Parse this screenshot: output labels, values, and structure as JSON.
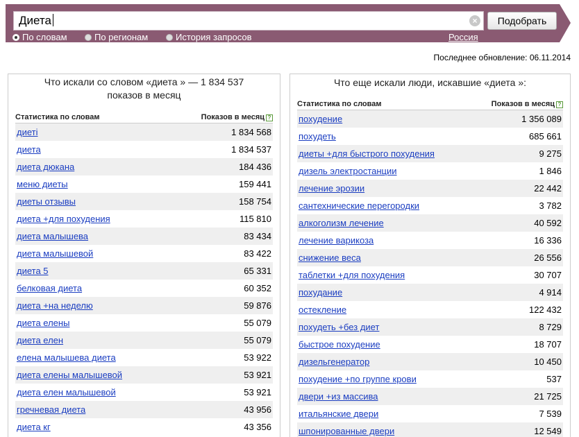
{
  "search": {
    "value": "Диета",
    "submit_label": "Подобрать"
  },
  "modes": [
    {
      "label": "По словам",
      "checked": true
    },
    {
      "label": "По регионам",
      "checked": false
    },
    {
      "label": "История запросов",
      "checked": false
    }
  ],
  "region": "Россия",
  "updated": "Последнее обновление: 06.11.2014",
  "left": {
    "title_line1": "Что искали со словом «диета » — 1 834 537",
    "title_line2": "показов в месяц",
    "col_keyword": "Статистика по словам",
    "col_count": "Показов в месяц",
    "rows": [
      {
        "keyword": "диеті",
        "count": "1 834 568"
      },
      {
        "keyword": "диета",
        "count": "1 834 537"
      },
      {
        "keyword": "диета дюкана",
        "count": "184 436"
      },
      {
        "keyword": "меню диеты",
        "count": "159 441"
      },
      {
        "keyword": "диеты отзывы",
        "count": "158 754"
      },
      {
        "keyword": "диета +для похудения",
        "count": "115 810"
      },
      {
        "keyword": "диета малышева",
        "count": "83 434"
      },
      {
        "keyword": "диета малышевой",
        "count": "83 422"
      },
      {
        "keyword": "диета 5",
        "count": "65 331"
      },
      {
        "keyword": "белковая диета",
        "count": "60 352"
      },
      {
        "keyword": "диета +на неделю",
        "count": "59 876"
      },
      {
        "keyword": "диета елены",
        "count": "55 079"
      },
      {
        "keyword": "диета елен",
        "count": "55 079"
      },
      {
        "keyword": "елена малышева диета",
        "count": "53 922"
      },
      {
        "keyword": "диета елены малышевой",
        "count": "53 921"
      },
      {
        "keyword": "диета елен малышевой",
        "count": "53 921"
      },
      {
        "keyword": "гречневая диета",
        "count": "43 956"
      },
      {
        "keyword": "диета кг",
        "count": "43 356"
      }
    ]
  },
  "right": {
    "title": "Что еще искали люди, искавшие «диета »:",
    "col_keyword": "Статистика по словам",
    "col_count": "Показов в месяц",
    "rows": [
      {
        "keyword": "похудение",
        "count": "1 356 089"
      },
      {
        "keyword": "похудеть",
        "count": "685 661"
      },
      {
        "keyword": "диеты +для быстрого похудения",
        "count": "9 275"
      },
      {
        "keyword": "дизель электростанции",
        "count": "1 846"
      },
      {
        "keyword": "лечение эрозии",
        "count": "22 442"
      },
      {
        "keyword": "сантехнические перегородки",
        "count": "3 782"
      },
      {
        "keyword": "алкоголизм лечение",
        "count": "40 592"
      },
      {
        "keyword": "лечение варикоза",
        "count": "16 336"
      },
      {
        "keyword": "снижение веса",
        "count": "26 556"
      },
      {
        "keyword": "таблетки +для похудения",
        "count": "30 707"
      },
      {
        "keyword": "похудание",
        "count": "4 914"
      },
      {
        "keyword": "остекление",
        "count": "122 432"
      },
      {
        "keyword": "похудеть +без диет",
        "count": "8 729"
      },
      {
        "keyword": "быстрое похудение",
        "count": "18 707"
      },
      {
        "keyword": "дизельгенератор",
        "count": "10 450"
      },
      {
        "keyword": "похудение +по группе крови",
        "count": "537"
      },
      {
        "keyword": "двери +из массива",
        "count": "21 725"
      },
      {
        "keyword": "итальянские двери",
        "count": "7 539"
      },
      {
        "keyword": "шпонированные двери",
        "count": "12 549"
      }
    ]
  }
}
